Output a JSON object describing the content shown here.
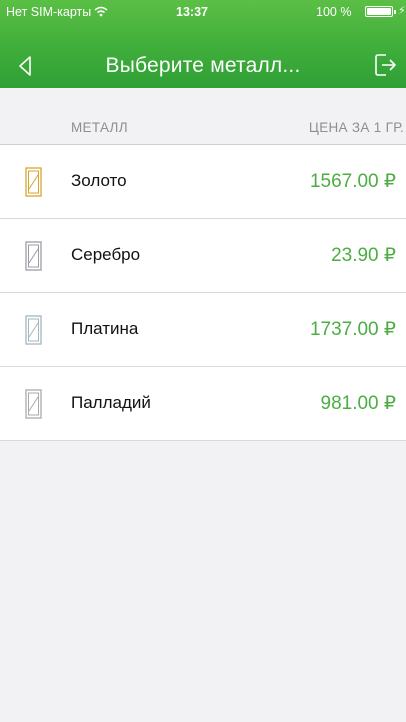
{
  "status_bar": {
    "carrier": "Нет SIM-карты",
    "time": "13:37",
    "battery": "100 %"
  },
  "nav": {
    "title": "Выберите металл...",
    "back_icon": "chevron-left-icon",
    "exit_icon": "logout-icon"
  },
  "columns": {
    "metal": "МЕТАЛЛ",
    "price": "ЦЕНА ЗА 1 ГР."
  },
  "metals": [
    {
      "name": "Золото",
      "price": "1567.00 ₽",
      "icon": "gold-bar-icon",
      "icon_color": "#d9a531"
    },
    {
      "name": "Серебро",
      "price": "23.90 ₽",
      "icon": "silver-bar-icon",
      "icon_color": "#9a9ea4"
    },
    {
      "name": "Платина",
      "price": "1737.00 ₽",
      "icon": "platinum-bar-icon",
      "icon_color": "#a3b6bf"
    },
    {
      "name": "Палладий",
      "price": "981.00 ₽",
      "icon": "palladium-bar-icon",
      "icon_color": "#a9aaac"
    }
  ],
  "colors": {
    "header_green": "#3fae3a",
    "price_green": "#4cae42",
    "header_text": "#ffffff",
    "muted_text": "#8e8e93"
  }
}
